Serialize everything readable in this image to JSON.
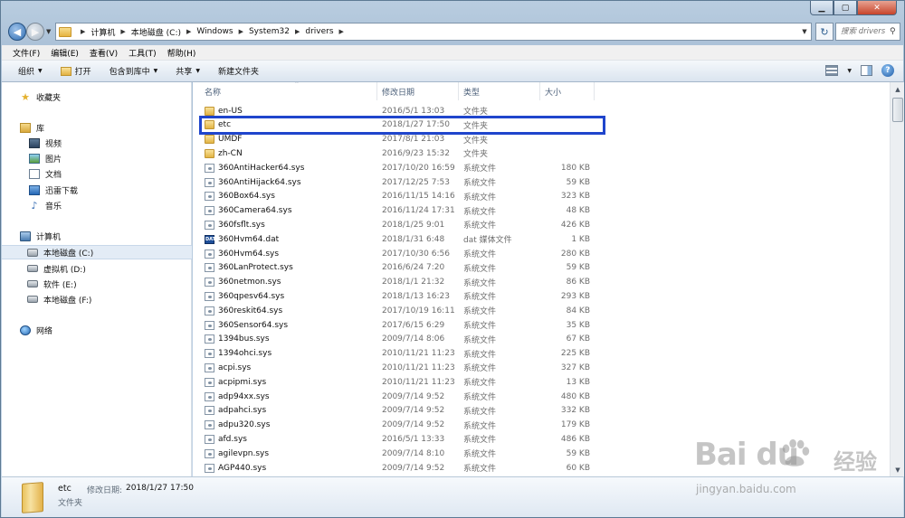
{
  "window": {
    "address_path": [
      "计算机",
      "本地磁盘 (C:)",
      "Windows",
      "System32",
      "drivers"
    ],
    "search_placeholder": "搜索 drivers"
  },
  "menubar": [
    "文件(F)",
    "编辑(E)",
    "查看(V)",
    "工具(T)",
    "帮助(H)"
  ],
  "toolbar": {
    "organize": "组织",
    "open": "打开",
    "include_library": "包含到库中",
    "share": "共享",
    "new_folder": "新建文件夹"
  },
  "navpane": {
    "favorites": "收藏夹",
    "libraries": "库",
    "library_items": [
      "视频",
      "图片",
      "文档",
      "迅雷下载",
      "音乐"
    ],
    "computer": "计算机",
    "drives": [
      "本地磁盘 (C:)",
      "虚拟机 (D:)",
      "软件 (E:)",
      "本地磁盘 (F:)"
    ],
    "network": "网络"
  },
  "columns": [
    "名称",
    "修改日期",
    "类型",
    "大小"
  ],
  "files": [
    {
      "name": "en-US",
      "date": "2016/5/1 13:03",
      "type": "文件夹",
      "size": "",
      "icon": "folder"
    },
    {
      "name": "etc",
      "date": "2018/1/27 17:50",
      "type": "文件夹",
      "size": "",
      "icon": "folder"
    },
    {
      "name": "UMDF",
      "date": "2017/8/1 21:03",
      "type": "文件夹",
      "size": "",
      "icon": "folder"
    },
    {
      "name": "zh-CN",
      "date": "2016/9/23 15:32",
      "type": "文件夹",
      "size": "",
      "icon": "folder"
    },
    {
      "name": "360AntiHacker64.sys",
      "date": "2017/10/20 16:59",
      "type": "系统文件",
      "size": "180 KB",
      "icon": "sys"
    },
    {
      "name": "360AntiHijack64.sys",
      "date": "2017/12/25 7:53",
      "type": "系统文件",
      "size": "59 KB",
      "icon": "sys"
    },
    {
      "name": "360Box64.sys",
      "date": "2016/11/15 14:16",
      "type": "系统文件",
      "size": "323 KB",
      "icon": "sys"
    },
    {
      "name": "360Camera64.sys",
      "date": "2016/11/24 17:31",
      "type": "系统文件",
      "size": "48 KB",
      "icon": "sys"
    },
    {
      "name": "360fsflt.sys",
      "date": "2018/1/25 9:01",
      "type": "系统文件",
      "size": "426 KB",
      "icon": "sys"
    },
    {
      "name": "360Hvm64.dat",
      "date": "2018/1/31 6:48",
      "type": "dat 媒体文件",
      "size": "1 KB",
      "icon": "dat"
    },
    {
      "name": "360Hvm64.sys",
      "date": "2017/10/30 6:56",
      "type": "系统文件",
      "size": "280 KB",
      "icon": "sys"
    },
    {
      "name": "360LanProtect.sys",
      "date": "2016/6/24 7:20",
      "type": "系统文件",
      "size": "59 KB",
      "icon": "sys"
    },
    {
      "name": "360netmon.sys",
      "date": "2018/1/1 21:32",
      "type": "系统文件",
      "size": "86 KB",
      "icon": "sys"
    },
    {
      "name": "360qpesv64.sys",
      "date": "2018/1/13 16:23",
      "type": "系统文件",
      "size": "293 KB",
      "icon": "sys"
    },
    {
      "name": "360reskit64.sys",
      "date": "2017/10/19 16:11",
      "type": "系统文件",
      "size": "84 KB",
      "icon": "sys"
    },
    {
      "name": "360Sensor64.sys",
      "date": "2017/6/15 6:29",
      "type": "系统文件",
      "size": "35 KB",
      "icon": "sys"
    },
    {
      "name": "1394bus.sys",
      "date": "2009/7/14 8:06",
      "type": "系统文件",
      "size": "67 KB",
      "icon": "sys"
    },
    {
      "name": "1394ohci.sys",
      "date": "2010/11/21 11:23",
      "type": "系统文件",
      "size": "225 KB",
      "icon": "sys"
    },
    {
      "name": "acpi.sys",
      "date": "2010/11/21 11:23",
      "type": "系统文件",
      "size": "327 KB",
      "icon": "sys"
    },
    {
      "name": "acpipmi.sys",
      "date": "2010/11/21 11:23",
      "type": "系统文件",
      "size": "13 KB",
      "icon": "sys"
    },
    {
      "name": "adp94xx.sys",
      "date": "2009/7/14 9:52",
      "type": "系统文件",
      "size": "480 KB",
      "icon": "sys"
    },
    {
      "name": "adpahci.sys",
      "date": "2009/7/14 9:52",
      "type": "系统文件",
      "size": "332 KB",
      "icon": "sys"
    },
    {
      "name": "adpu320.sys",
      "date": "2009/7/14 9:52",
      "type": "系统文件",
      "size": "179 KB",
      "icon": "sys"
    },
    {
      "name": "afd.sys",
      "date": "2016/5/1 13:33",
      "type": "系统文件",
      "size": "486 KB",
      "icon": "sys"
    },
    {
      "name": "agilevpn.sys",
      "date": "2009/7/14 8:10",
      "type": "系统文件",
      "size": "59 KB",
      "icon": "sys"
    },
    {
      "name": "AGP440.sys",
      "date": "2009/7/14 9:52",
      "type": "系统文件",
      "size": "60 KB",
      "icon": "sys"
    }
  ],
  "highlighted_file": "etc",
  "details": {
    "name": "etc",
    "date_label": "修改日期:",
    "date": "2018/1/27 17:50",
    "type": "文件夹"
  },
  "watermark": {
    "brand": "Bai du",
    "cn": "经验",
    "url": "jingyan.baidu.com"
  },
  "colors": {
    "highlight_border": "#1f45cc",
    "selection_bg": "#e3ecf6"
  }
}
